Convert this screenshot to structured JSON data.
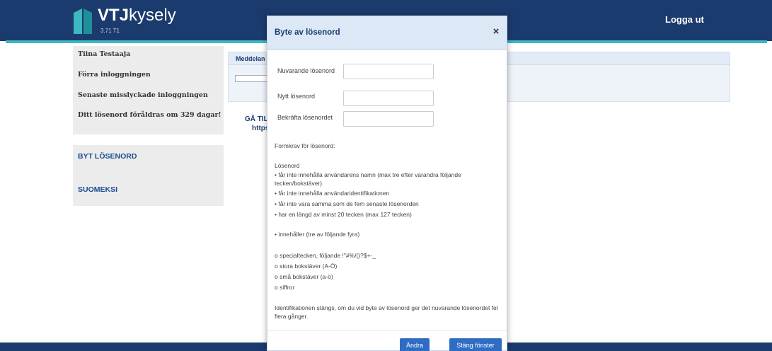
{
  "header": {
    "brand_bold": "VTJ",
    "brand_rest": "kysely",
    "version": "3.71 T1",
    "logout_label": "Logga ut"
  },
  "sidebar": {
    "user_name": "Tiina Testaaja",
    "last_login_label": "Förra inloggningen",
    "last_failed_label": "Senaste misslyckade inloggningen",
    "password_expiry": "Ditt lösenord föråldras om 329 dagar!",
    "links": [
      {
        "label": "BYT LÖSENORD"
      },
      {
        "label": "SUOMEKSI"
      }
    ]
  },
  "main": {
    "messages_title": "Meddelan",
    "go_text": "GÅ TIL",
    "go_url": "https"
  },
  "modal": {
    "title": "Byte av lösenord",
    "close_icon": "×",
    "fields": {
      "current_label": "Nuvarande lösenord",
      "new_label": "Nytt lösenord",
      "confirm_label": "Bekräfta lösenordet",
      "current_value": "",
      "new_value": "",
      "confirm_value": ""
    },
    "requirements": {
      "heading": "Formkrav för lösenord:",
      "subheading": "Lösenord",
      "rule1": "• får inte innehålla användarens namn (max tre efter varandra följande tecken/bokstäver)",
      "rule2": "• får inte innehålla användaridentifikationen",
      "rule3": "• får inte vara samma som de fem senaste lösenorden",
      "rule4": "• har en längd av minst 20 tecken (max 127 tecken)",
      "rule5": "• innehåller (tre av följande fyra)",
      "opt1": "o specialtecken, följande !\"#%/()?$+-_",
      "opt2": "o stora bokstäver (A-Ö)",
      "opt3": "o små bokstäver (a-ö)",
      "opt4": "o siffror",
      "note": "Identifikationen stängs, om du vid byte av lösenord ger det nuvarande lösenordet fel flera gånger."
    },
    "buttons": {
      "change_label": "Ändra",
      "close_label": "Stäng fönster"
    }
  },
  "colors": {
    "header_bg": "#1b3a6d",
    "accent": "#3bb8c0",
    "button": "#2f6cc4",
    "link": "#1a4d8e"
  },
  "icons": {
    "logo": "vtj-logo-icon",
    "close": "close-icon"
  }
}
